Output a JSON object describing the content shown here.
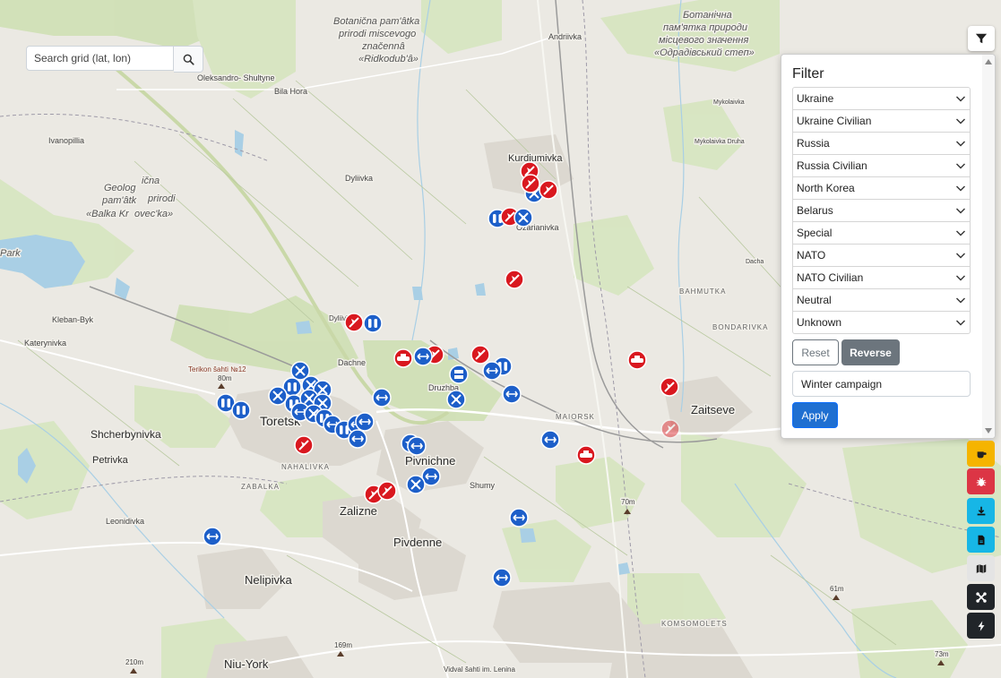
{
  "search": {
    "placeholder": "Search grid (lat, lon)",
    "button_icon": "search-icon"
  },
  "filter_toggle": {
    "icon": "filter-icon"
  },
  "filter": {
    "title": "Filter",
    "categories": [
      "Ukraine",
      "Ukraine Civilian",
      "Russia",
      "Russia Civilian",
      "North Korea",
      "Belarus",
      "Special",
      "NATO",
      "NATO Civilian",
      "Neutral",
      "Unknown"
    ],
    "reset_label": "Reset",
    "reverse_label": "Reverse",
    "campaign_value": "Winter campaign",
    "apply_label": "Apply"
  },
  "toolbar": [
    {
      "icon": "coffee-icon",
      "color": "#f5b400"
    },
    {
      "icon": "bug-icon",
      "color": "#dc3545"
    },
    {
      "icon": "download-icon",
      "color": "#17b6e6"
    },
    {
      "icon": "document-icon",
      "color": "#17b6e6"
    },
    {
      "icon": "map-icon",
      "color": "#e4e4e4"
    },
    {
      "icon": "drone-icon",
      "color": "#212529"
    },
    {
      "icon": "lightning-icon",
      "color": "#212529"
    }
  ],
  "colors": {
    "ukraine_marker": "#1d5fc9",
    "russia_marker": "#d9181f"
  },
  "map": {
    "labels": {
      "andriivka": "Andriivka",
      "oleksandro_shultyne": "Oleksandro-\nShultyne",
      "bila_hora": "Bila Hora",
      "ivanopillia": "Ivanopillia",
      "kurdiumivka": "Kurdiumivka",
      "ozarianivka": "Ozarianivka",
      "dyliivka": "Dyliivka",
      "mykolaivka": "Mykolaivka",
      "mykolaivka_druha": "Mykolaivka Druha",
      "dacha": "Dacha",
      "bahmutka": "BAHMUTKA",
      "bondarivka": "BONDARIVKA",
      "kleban_byk": "Kleban-Byk",
      "katerynivka": "Katerynivka",
      "dyliivka2": "Dyliivka",
      "dachne": "Dachne",
      "druzhba": "Druzhba",
      "terikon": "Terikon šahti №12",
      "elev80": "80m",
      "toretsk": "Toretsk",
      "maiorsk": "MAIORSK",
      "zaitseve": "Zaitseve",
      "shcherbynivka": "Shcherbynivka",
      "petrivka": "Petrivka",
      "nahalivka": "NAHALIVKA",
      "zabalka": "ZABALKA",
      "pivnichne": "Pivnichne",
      "shumy": "Shumy",
      "elev70": "70m",
      "leonidivka": "Leonidivka",
      "zalizne": "Zalizne",
      "pivdenne": "Pivdenne",
      "nelipivka": "Nelipivka",
      "elev61": "61m",
      "komsomolets": "KOMSOMOLETS",
      "elev210": "210m",
      "elev169": "169m",
      "niu_york": "Niu-York",
      "vidval": "Vidval šahti im. Lenina",
      "elev73": "73m",
      "nature_top_1": "Botanična pam'âtka",
      "nature_top_2": "prirodi miscevogo",
      "nature_top_3": "značennâ",
      "nature_top_4": "«Ridkodub'â»",
      "nature_right_1": "Ботанічна",
      "nature_right_2": "пам'ятка природи",
      "nature_right_3": "місцевого значення",
      "nature_right_4": "«Одрадівський степ»",
      "nature_left_1": "Geolog",
      "nature_left_2": "ična",
      "nature_left_3": "pam'âtk",
      "nature_left_4": "prirodi",
      "nature_left_5": "«Balka Kr",
      "nature_left_6": "ovec'ka»",
      "park_1": "Park"
    }
  }
}
